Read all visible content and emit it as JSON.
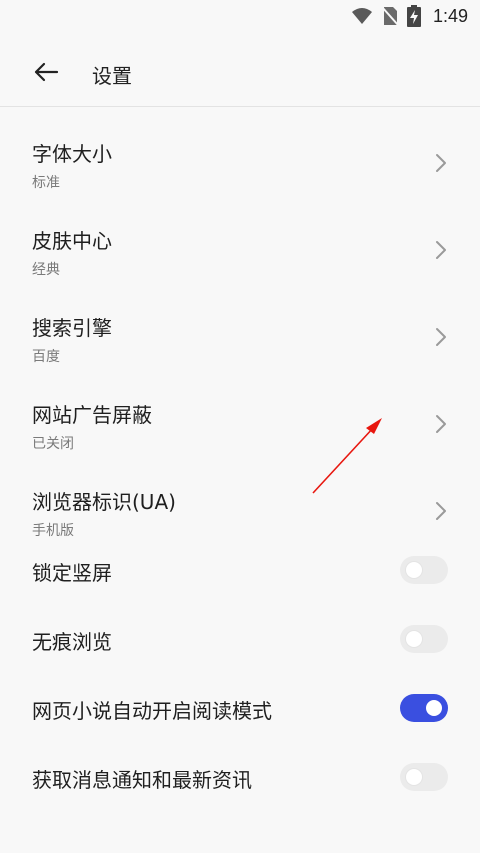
{
  "status_bar": {
    "time": "1:49"
  },
  "app_bar": {
    "title": "设置"
  },
  "nav_items": [
    {
      "title": "字体大小",
      "subtitle": "标准"
    },
    {
      "title": "皮肤中心",
      "subtitle": "经典"
    },
    {
      "title": "搜索引擎",
      "subtitle": "百度"
    },
    {
      "title": "网站广告屏蔽",
      "subtitle": "已关闭"
    },
    {
      "title": "浏览器标识(UA)",
      "subtitle": "手机版"
    }
  ],
  "toggles": [
    {
      "title": "锁定竖屏",
      "on": false
    },
    {
      "title": "无痕浏览",
      "on": false
    },
    {
      "title": "网页小说自动开启阅读模式",
      "on": true
    },
    {
      "title": "获取消息通知和最新资讯",
      "on": false
    }
  ],
  "colors": {
    "accent": "#3a4fe0",
    "annotation": "#e8170f"
  }
}
